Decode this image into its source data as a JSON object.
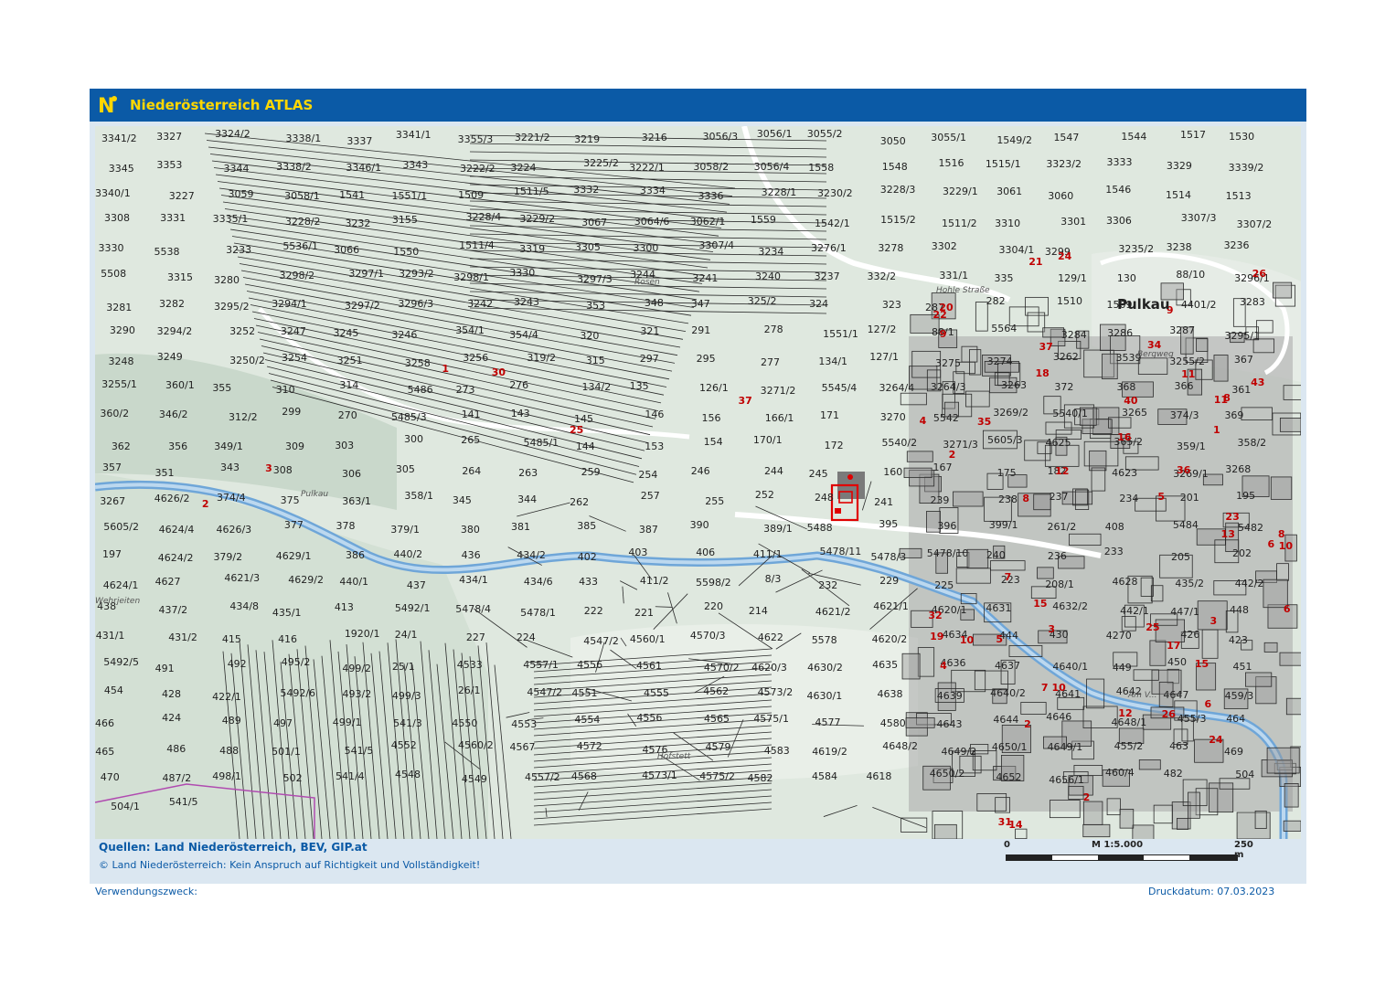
{
  "header": {
    "title": "Niederösterreich ATLAS",
    "logo_letter": "N"
  },
  "map": {
    "parcel_labels": [
      "3341/2",
      "3327",
      "3324/2",
      "3338/1",
      "3337",
      "3341/1",
      "3355/3",
      "3221/2",
      "3219",
      "3216",
      "3056/3",
      "3056/1",
      "3055/2",
      "3050",
      "3055/1",
      "1549/2",
      "1547",
      "1544",
      "1517",
      "1530",
      "3345",
      "3353",
      "3344",
      "3338/2",
      "3346/1",
      "3343",
      "3222/2",
      "3224",
      "3225/2",
      "3222/1",
      "3058/2",
      "3056/4",
      "1558",
      "1548",
      "1516",
      "1515/1",
      "3323/2",
      "3333",
      "3329",
      "3339/2",
      "3340/1",
      "3227",
      "3059",
      "3058/1",
      "1541",
      "1551/1",
      "1509",
      "1511/5",
      "3332",
      "3334",
      "3336",
      "3228/1",
      "3230/2",
      "3228/3",
      "3229/1",
      "3061",
      "3060",
      "1546",
      "1514",
      "1513",
      "3308",
      "3331",
      "3335/1",
      "3228/2",
      "3232",
      "3155",
      "3228/4",
      "3229/2",
      "3067",
      "3064/6",
      "3062/1",
      "1559",
      "1542/1",
      "1515/2",
      "1511/2",
      "3310",
      "3301",
      "3306",
      "3307/3",
      "3307/2",
      "3330",
      "5538",
      "3233",
      "5536/1",
      "3066",
      "1550",
      "1511/4",
      "3319",
      "3305",
      "3300",
      "3307/4",
      "3234",
      "3276/1",
      "3278",
      "3302",
      "3304/1",
      "3299",
      "3235/2",
      "3238",
      "3236",
      "5508",
      "3315",
      "3280",
      "3298/2",
      "3297/1",
      "3293/2",
      "3298/1",
      "3330",
      "3297/3",
      "3244",
      "3241",
      "3240",
      "3237",
      "332/2",
      "331/1",
      "335",
      "129/1",
      "130",
      "88/10",
      "3296/1",
      "3281",
      "3282",
      "3295/2",
      "3294/1",
      "3297/2",
      "3296/3",
      "3242",
      "3243",
      "353",
      "348",
      "347",
      "325/2",
      "324",
      "323",
      "287",
      "282",
      "1510",
      "1509",
      "4401/2",
      "3283",
      "3290",
      "3294/2",
      "3252",
      "3247",
      "3245",
      "3246",
      "354/1",
      "354/4",
      "320",
      "321",
      "291",
      "278",
      "1551/1",
      "127/2",
      "88/1",
      "5564",
      "3284",
      "3286",
      "3287",
      "3295/1",
      "3248",
      "3249",
      "3250/2",
      "3254",
      "3251",
      "3258",
      "3256",
      "319/2",
      "315",
      "297",
      "295",
      "277",
      "134/1",
      "127/1",
      "3275",
      "3274",
      "3262",
      "3539",
      "3255/2",
      "367",
      "3255/1",
      "360/1",
      "355",
      "310",
      "314",
      "5486",
      "273",
      "276",
      "134/2",
      "135",
      "126/1",
      "3271/2",
      "5545/4",
      "3264/4",
      "3264/3",
      "3263",
      "372",
      "368",
      "366",
      "361",
      "360/2",
      "346/2",
      "312/2",
      "299",
      "270",
      "5485/3",
      "141",
      "143",
      "145",
      "146",
      "156",
      "166/1",
      "171",
      "3270",
      "5542",
      "3269/2",
      "5540/1",
      "3265",
      "374/3",
      "369",
      "362",
      "356",
      "349/1",
      "309",
      "303",
      "300",
      "265",
      "5485/1",
      "144",
      "153",
      "154",
      "170/1",
      "172",
      "5540/2",
      "3271/3",
      "5605/3",
      "4625",
      "365/2",
      "359/1",
      "358/2",
      "357",
      "351",
      "343",
      "308",
      "306",
      "305",
      "264",
      "263",
      "259",
      "254",
      "246",
      "244",
      "245",
      "160",
      "167",
      "175",
      "182",
      "4623",
      "3269/1",
      "3268",
      "3267",
      "4626/2",
      "374/4",
      "375",
      "363/1",
      "358/1",
      "345",
      "344",
      "262",
      "257",
      "255",
      "252",
      "248",
      "241",
      "239",
      "238",
      "237",
      "234",
      "201",
      "195",
      "5605/2",
      "4624/4",
      "4626/3",
      "377",
      "378",
      "379/1",
      "380",
      "381",
      "385",
      "387",
      "390",
      "389/1",
      "5488",
      "395",
      "396",
      "399/1",
      "261/2",
      "408",
      "5484",
      "5482",
      "197",
      "4624/2",
      "379/2",
      "4629/1",
      "386",
      "440/2",
      "436",
      "434/2",
      "402",
      "403",
      "406",
      "411/1",
      "5478/11",
      "5478/3",
      "5478/10",
      "240",
      "236",
      "233",
      "205",
      "202",
      "4624/1",
      "4627",
      "4621/3",
      "4629/2",
      "440/1",
      "437",
      "434/1",
      "434/6",
      "433",
      "411/2",
      "5598/2",
      "8/3",
      "232",
      "229",
      "225",
      "223",
      "208/1",
      "4628",
      "435/2",
      "442/2",
      "438",
      "437/2",
      "434/8",
      "435/1",
      "413",
      "5492/1",
      "5478/4",
      "5478/1",
      "222",
      "221",
      "220",
      "214",
      "4621/2",
      "4621/1",
      "4620/1",
      "4631",
      "4632/2",
      "442/1",
      "447/1",
      "448",
      "431/1",
      "431/2",
      "415",
      "416",
      "1920/1",
      "24/1",
      "227",
      "224",
      "4547/2",
      "4560/1",
      "4570/3",
      "4622",
      "5578",
      "4620/2",
      "4634",
      "444",
      "430",
      "4270",
      "426",
      "423",
      "5492/5",
      "491",
      "492",
      "495/2",
      "499/2",
      "25/1",
      "4533",
      "4557/1",
      "4556",
      "4561",
      "4570/2",
      "4620/3",
      "4630/2",
      "4635",
      "4636",
      "4637",
      "4640/1",
      "449",
      "450",
      "451",
      "454",
      "428",
      "422/1",
      "5492/6",
      "493/2",
      "499/3",
      "26/1",
      "4547/2",
      "4551",
      "4555",
      "4562",
      "4573/2",
      "4630/1",
      "4638",
      "4639",
      "4640/2",
      "4641",
      "4642",
      "4647",
      "459/3",
      "466",
      "424",
      "489",
      "497",
      "499/1",
      "541/3",
      "4550",
      "4553",
      "4554",
      "4556",
      "4565",
      "4575/1",
      "4577",
      "4580",
      "4643",
      "4644",
      "4646",
      "4648/1",
      "455/3",
      "464",
      "465",
      "486",
      "488",
      "501/1",
      "541/5",
      "4552",
      "4560/2",
      "4567",
      "4572",
      "4576",
      "4579",
      "4583",
      "4619/2",
      "4648/2",
      "4649/2",
      "4650/1",
      "4649/1",
      "455/2",
      "463",
      "469",
      "470",
      "487/2",
      "498/1",
      "502",
      "541/4",
      "4548",
      "4549",
      "4557/2",
      "4568",
      "4573/1",
      "4575/2",
      "4582",
      "4584",
      "4618",
      "4650/2",
      "4652",
      "4656/1",
      "460/4",
      "482",
      "504",
      "504/1",
      "541/5"
    ],
    "house_numbers": [
      "25",
      "2",
      "1",
      "30",
      "37",
      "3",
      "26",
      "24",
      "10",
      "8",
      "6",
      "2",
      "13",
      "15",
      "18",
      "16",
      "12",
      "11",
      "8",
      "9",
      "4",
      "6",
      "2",
      "3",
      "7",
      "5",
      "10",
      "14",
      "15",
      "17",
      "19",
      "20",
      "21",
      "22",
      "23",
      "24",
      "25",
      "26",
      "31",
      "32",
      "34",
      "35",
      "36",
      "37",
      "40",
      "43",
      "12",
      "11",
      "10",
      "9",
      "8",
      "7",
      "6",
      "5",
      "4",
      "3",
      "2",
      "1"
    ],
    "place_labels": [
      "Wehrjeiten",
      "Rosen",
      "Hofstett",
      "Pulkau",
      "Hohle Straße",
      "Bergweg",
      "Am V..."
    ],
    "place_name_big": "Pulkau",
    "target_parcel": "344"
  },
  "footer": {
    "sources_label": "Quellen: Land Niederösterreich, BEV, GIP.at",
    "copyright": "© Land Niederösterreich: Kein Anspruch auf Richtigkeit und Vollständigkeit!",
    "purpose_label": "Verwendungszweck:",
    "print_date": "Druckdatum: 07.03.2023"
  },
  "scale": {
    "zero": "0",
    "ratio": "M 1:5.000",
    "end": "250 m"
  },
  "colors": {
    "header_bg": "#0b5aa6",
    "header_text": "#ffd700",
    "river": "#6fa6d8",
    "parcel_line": "#2a2a2a",
    "house_number": "#c00000",
    "target": "#e00000",
    "building": "#8c8c8c",
    "terrain": "#c9d8cb",
    "boundary_purple": "#b04bb0"
  }
}
